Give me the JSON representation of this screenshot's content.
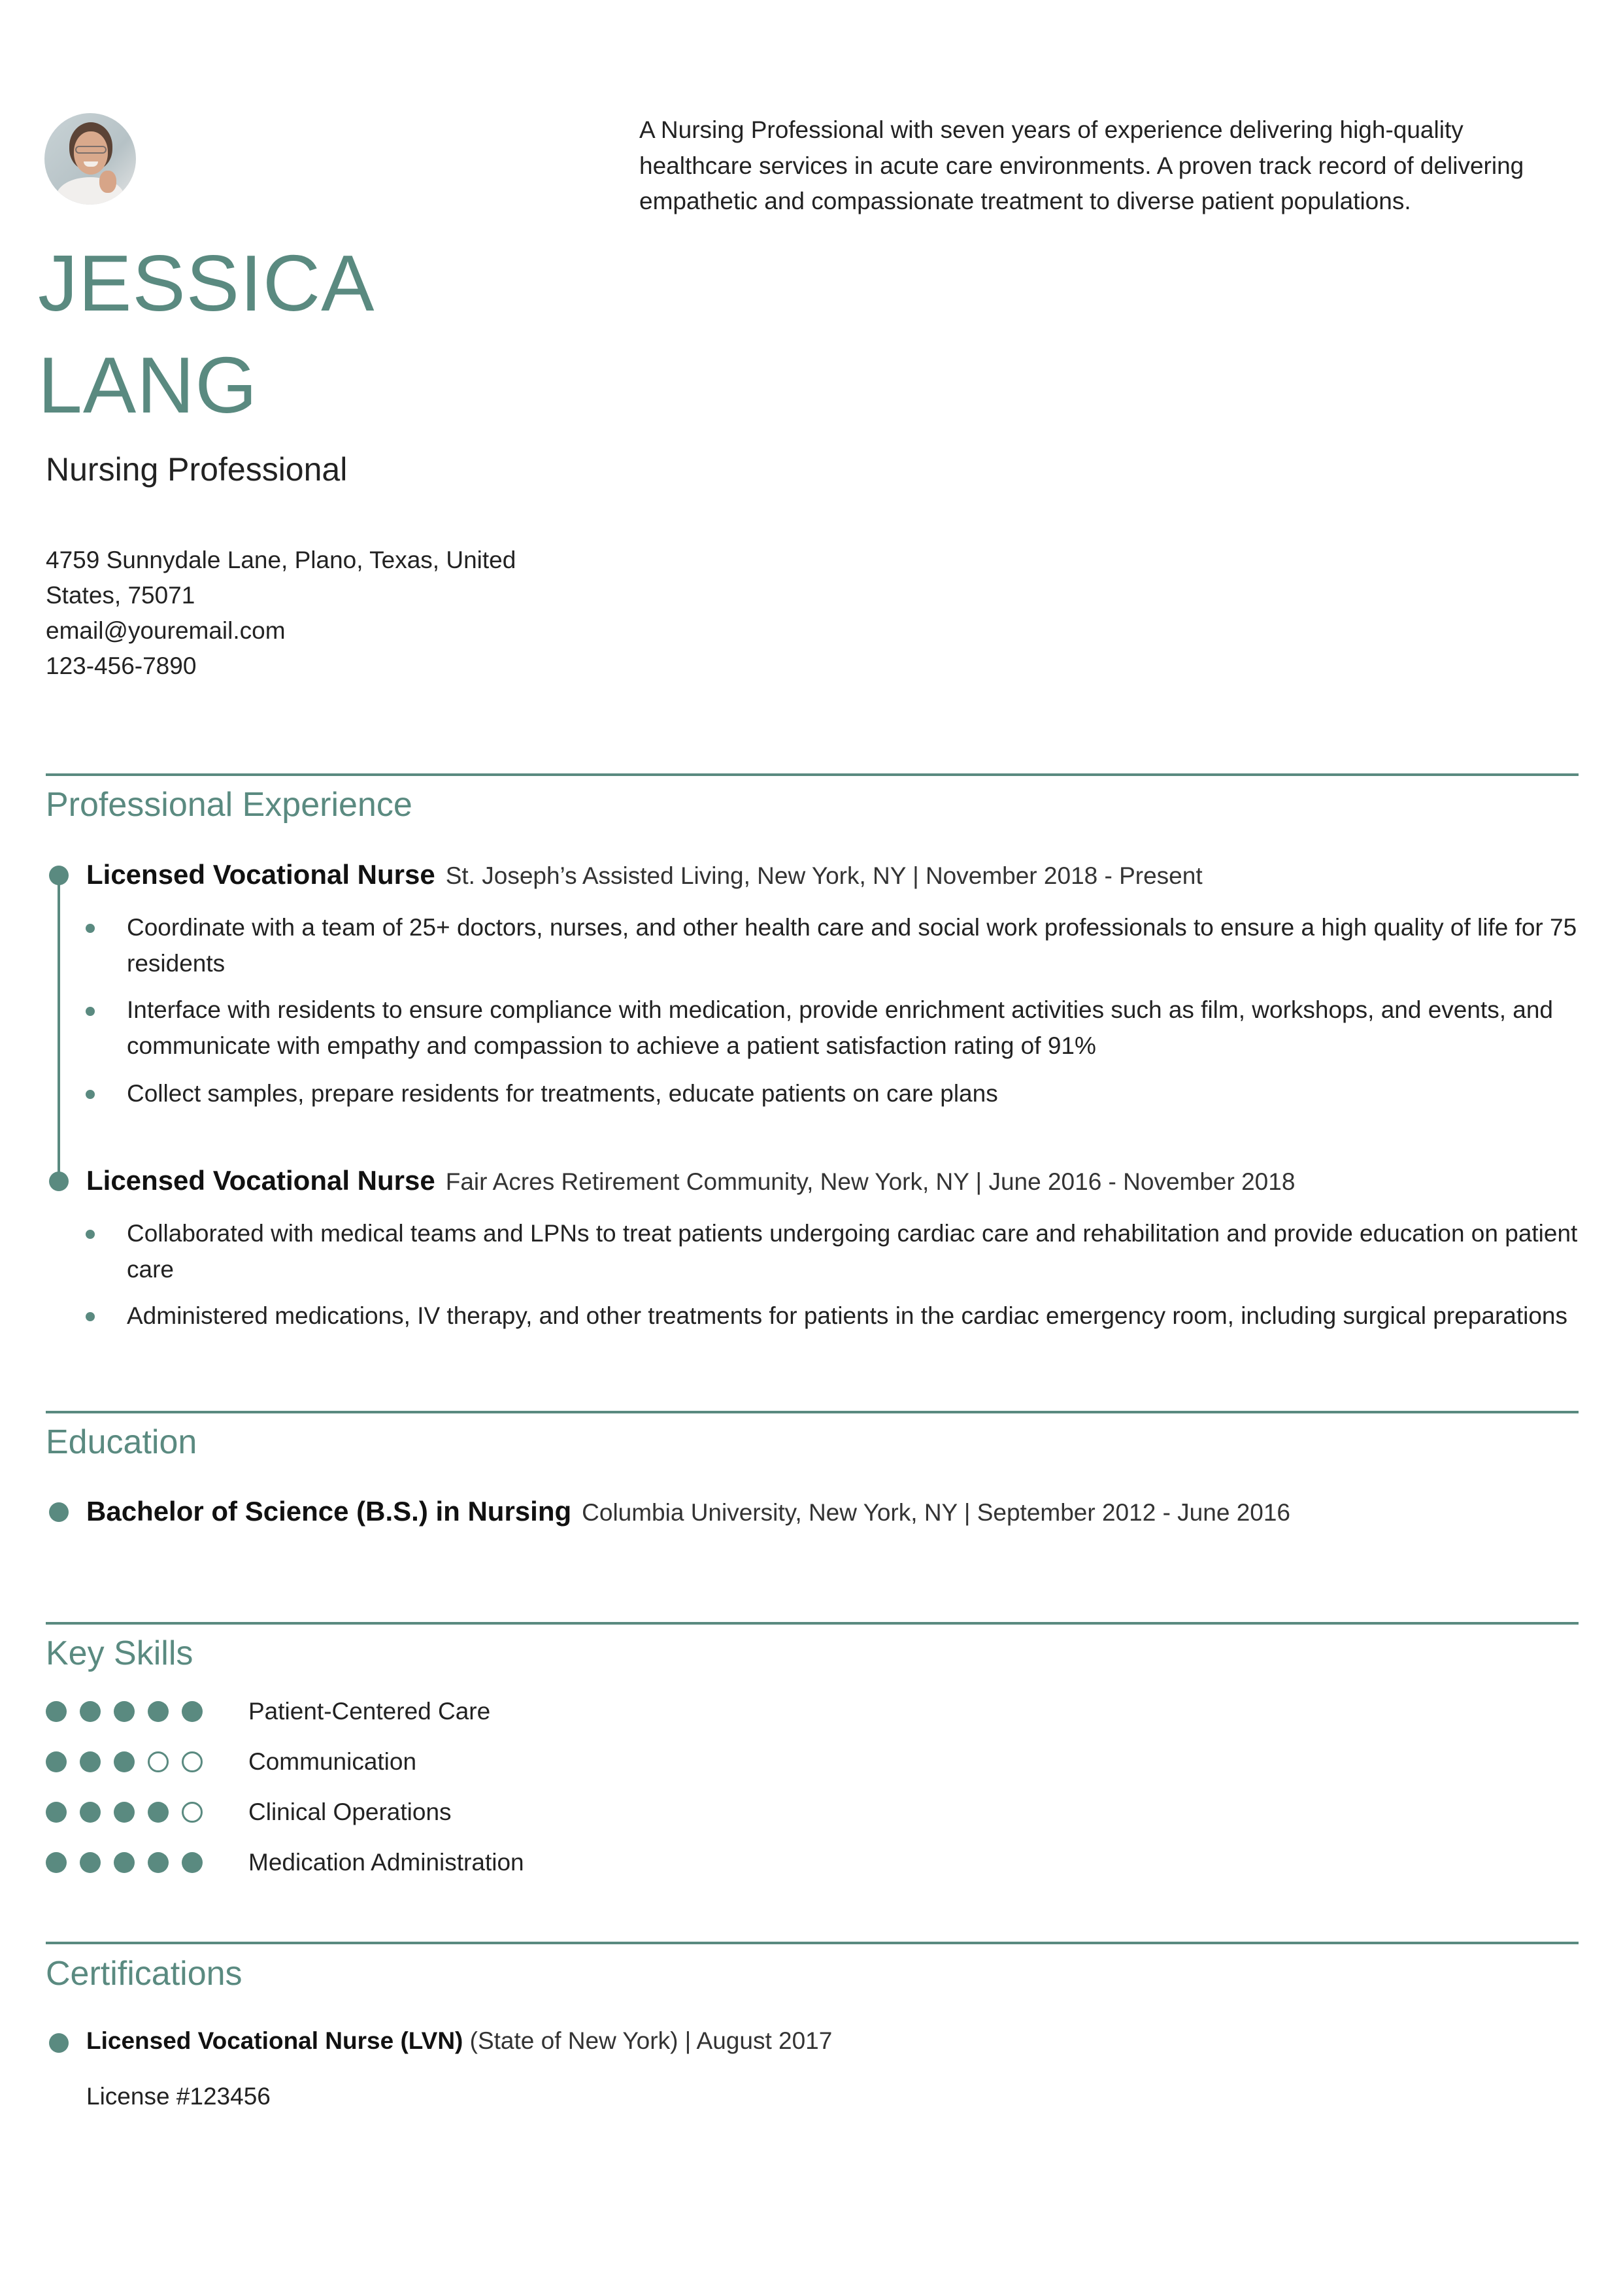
{
  "profile": {
    "photo_alt": "Profile photo",
    "first_name": "JESSICA",
    "last_name": "LANG",
    "title": "Nursing Professional",
    "summary": "A Nursing Professional with seven years of experience delivering high-quality healthcare services in acute care environments. A proven track record of delivering empathetic and compassionate treatment to diverse patient populations."
  },
  "contact": {
    "address_line1": "4759 Sunnydale Lane, Plano, Texas, United",
    "address_line2": "States, 75071",
    "email": "email@youremail.com",
    "phone": "123-456-7890"
  },
  "colors": {
    "accent": "#5a8a80",
    "text": "#222222"
  },
  "sections": {
    "experience": {
      "heading": "Professional Experience",
      "jobs": [
        {
          "role": "Licensed Vocational Nurse",
          "meta": "St. Joseph’s Assisted Living, New York, NY | November 2018 - Present",
          "bullets": [
            "Coordinate with a team of 25+ doctors, nurses, and other health care and social work professionals to ensure a high quality of life for 75 residents",
            "Interface with residents to ensure compliance with medication, provide enrichment activities such as film, workshops, and events, and communicate with empathy and compassion to achieve a patient satisfaction rating of 91%",
            "Collect samples, prepare residents for treatments, educate patients on care plans"
          ]
        },
        {
          "role": "Licensed Vocational Nurse",
          "meta": "Fair Acres Retirement Community, New York, NY | June 2016 - November 2018",
          "bullets": [
            "Collaborated with medical teams and LPNs to treat patients undergoing cardiac care and rehabilitation and provide education on patient care",
            "Administered medications, IV therapy, and other treatments for patients in the cardiac emergency room, including surgical preparations"
          ]
        }
      ]
    },
    "education": {
      "heading": "Education",
      "entries": [
        {
          "degree": "Bachelor of Science (B.S.) in Nursing",
          "meta": "Columbia University, New York, NY | September 2012 - June 2016"
        }
      ]
    },
    "skills": {
      "heading": "Key Skills",
      "max_level": 5,
      "items": [
        {
          "label": "Patient-Centered Care",
          "level": 5
        },
        {
          "label": "Communication",
          "level": 3
        },
        {
          "label": "Clinical Operations",
          "level": 4
        },
        {
          "label": "Medication Administration",
          "level": 5
        }
      ]
    },
    "certifications": {
      "heading": "Certifications",
      "entries": [
        {
          "name": "Licensed Vocational Nurse (LVN)",
          "meta": " (State of New York) | August 2017",
          "detail": "License #123456"
        }
      ]
    }
  }
}
